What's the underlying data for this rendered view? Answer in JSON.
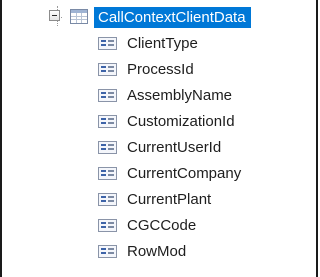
{
  "tree": {
    "root": {
      "label": "CallContextClientData",
      "icon": "table-icon",
      "expanded": true,
      "selected": true,
      "highlight_color": "#0078d7"
    },
    "children": [
      {
        "label": "ClientType",
        "icon": "field-icon"
      },
      {
        "label": "ProcessId",
        "icon": "field-icon"
      },
      {
        "label": "AssemblyName",
        "icon": "field-icon"
      },
      {
        "label": "CustomizationId",
        "icon": "field-icon"
      },
      {
        "label": "CurrentUserId",
        "icon": "field-icon"
      },
      {
        "label": "CurrentCompany",
        "icon": "field-icon"
      },
      {
        "label": "CurrentPlant",
        "icon": "field-icon"
      },
      {
        "label": "CGCCode",
        "icon": "field-icon"
      },
      {
        "label": "RowMod",
        "icon": "field-icon"
      }
    ]
  }
}
